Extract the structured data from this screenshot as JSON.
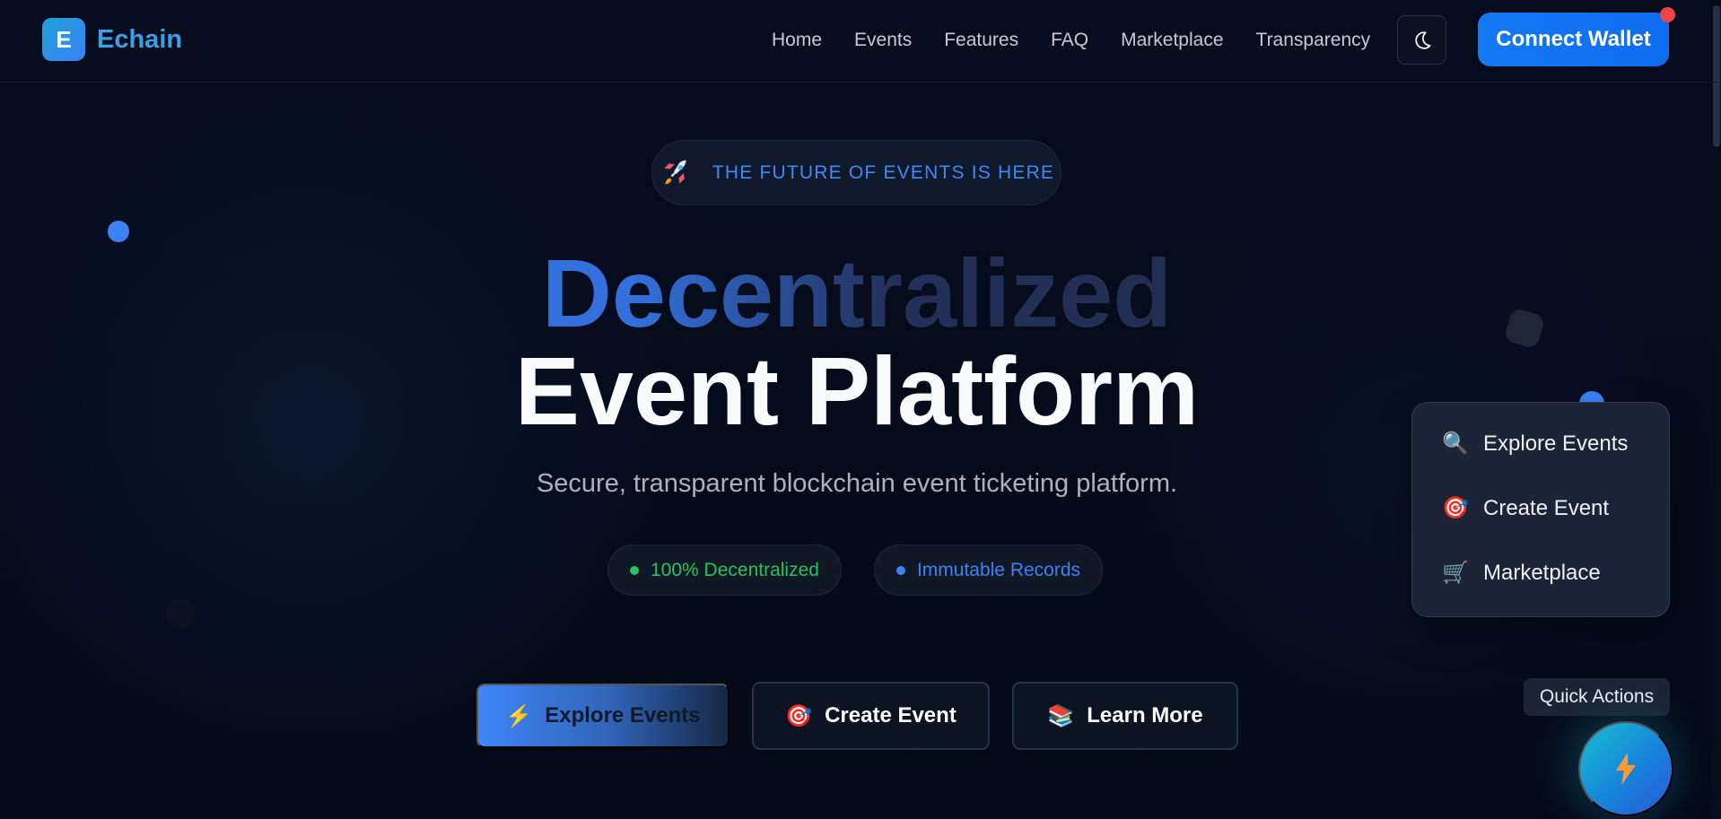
{
  "brand": {
    "logo_letter": "E",
    "name": "Echain"
  },
  "nav": {
    "items": [
      {
        "label": "Home"
      },
      {
        "label": "Events"
      },
      {
        "label": "Features"
      },
      {
        "label": "FAQ"
      },
      {
        "label": "Marketplace"
      },
      {
        "label": "Transparency"
      }
    ],
    "theme_icon": "moon-icon",
    "connect_label": "Connect Wallet"
  },
  "hero": {
    "badge_icon": "rocket-icon",
    "badge_text": "THE FUTURE OF EVENTS IS HERE",
    "headline_line_1": "Decentralized",
    "headline_line_2": "Event Platform",
    "subtitle": "Secure, transparent blockchain event ticketing platform.",
    "pills": [
      {
        "label": "100% Decentralized",
        "color": "#22c55e"
      },
      {
        "label": "Immutable Records",
        "color": "#3b82f6"
      }
    ],
    "cta": [
      {
        "label": "Explore Events",
        "icon": "lightning-icon"
      },
      {
        "label": "Create Event",
        "icon": "target-icon"
      },
      {
        "label": "Learn More",
        "icon": "books-icon"
      }
    ]
  },
  "quick_actions": {
    "menu": [
      {
        "label": "Explore Events",
        "icon": "magnifier-icon"
      },
      {
        "label": "Create Event",
        "icon": "target-icon"
      },
      {
        "label": "Marketplace",
        "icon": "cart-icon"
      }
    ],
    "label": "Quick Actions",
    "button_icon": "lightning-icon"
  },
  "colors": {
    "background": "#050a18",
    "accent": "#3b82f6",
    "button_blue": "#1479f4",
    "notification": "#ef4444",
    "panel": "#1b2537"
  }
}
